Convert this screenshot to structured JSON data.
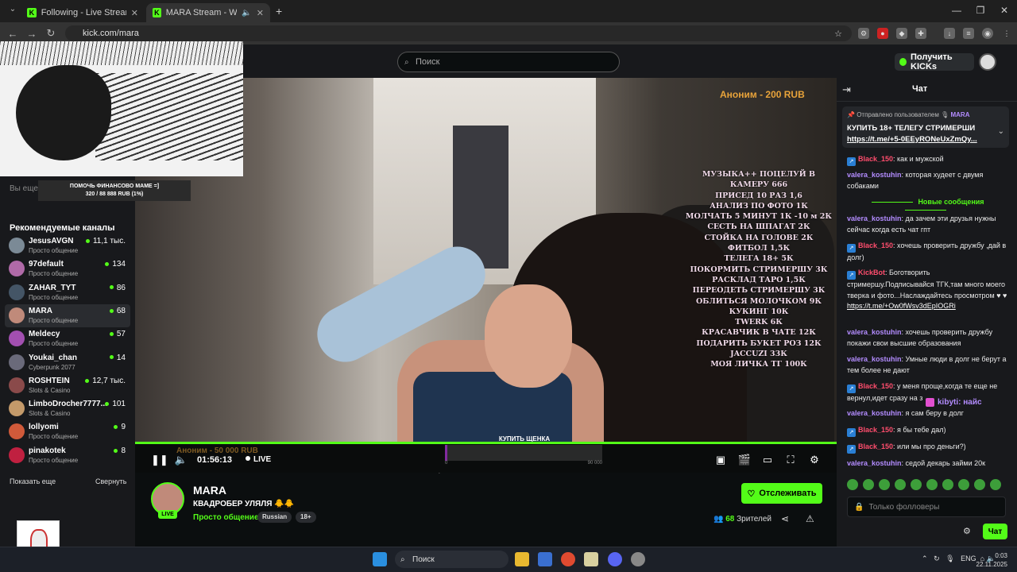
{
  "browser": {
    "tabs": [
      {
        "title": "Following - Live Streams on Kick",
        "active": false
      },
      {
        "title": "MARA Stream - Watch Live",
        "active": true
      }
    ],
    "url": "kick.com/mara",
    "add_tab_icon": "plus-icon"
  },
  "header": {
    "search_placeholder": "Поиск",
    "kicks_button": "Получить KICKs"
  },
  "overlay": {
    "donation_goal_title": "ПОМОЧЬ ФИНАНСОВО МАМЕ =]",
    "donation_goal_progress": "320 / 88 888 RUB (1%)",
    "donation_goal_fraction": 0.0036
  },
  "sidebar": {
    "following_text": "Вы еще ... один канал.",
    "recommended_title": "Рекомендуемые каналы",
    "channels": [
      {
        "name": "JesusAVGN",
        "category": "Просто общение",
        "viewers": "11,1 тыс.",
        "color": "#7b8a96"
      },
      {
        "name": "97default",
        "category": "Просто общение",
        "viewers": "134",
        "color": "#b06aa8"
      },
      {
        "name": "ZAHAR_TYT",
        "category": "Просто общение",
        "viewers": "86",
        "color": "#445566"
      },
      {
        "name": "MARA",
        "category": "Просто общение",
        "viewers": "68",
        "color": "#c08a7a"
      },
      {
        "name": "Meldecy",
        "category": "Просто общение",
        "viewers": "57",
        "color": "#a24fb0"
      },
      {
        "name": "Youkai_chan",
        "category": "Cyberpunk 2077",
        "viewers": "14",
        "color": "#6a6a7a"
      },
      {
        "name": "ROSHTEIN",
        "category": "Slots & Casino",
        "viewers": "12,7 тыс.",
        "color": "#8a4a4a"
      },
      {
        "name": "LimboDrocher7777...",
        "category": "Slots & Casino",
        "viewers": "101",
        "color": "#c49a6a"
      },
      {
        "name": "lollyomi",
        "category": "Просто общение",
        "viewers": "9",
        "color": "#d05a3a"
      },
      {
        "name": "pinakotek",
        "category": "Просто общение",
        "viewers": "8",
        "color": "#c02040"
      }
    ],
    "show_more": "Показать еще",
    "collapse": "Свернуть"
  },
  "video": {
    "donation_top": "Аноним - 200 RUB",
    "menu_lines": [
      "МУЗЫКА++ ПОЦЕЛУЙ В КАМЕРУ 666",
      "ПРИСЕД 10 РАЗ 1,6",
      "АНАЛИЗ ПО ФОТО 1К",
      "МОЛЧАТЬ 5 МИНУТ 1К -10 м 2К",
      "СЕСТЬ НА ШПАГАТ 2К",
      "СТОЙКА НА ГОЛОВЕ 2К",
      "ФИТБОЛ 1,5К",
      "ТЕЛЕГА 18+ 5К",
      "ПОКОРМИТЬ СТРИМЕРШУ 3К",
      "РАСКЛАД ТАРО 1,5К",
      "ПЕРЕОДЕТЬ СТРИМЕРШУ 3К",
      "ОБЛИТЬСЯ МОЛОЧКОМ 9К",
      "КУКИНГ 10К",
      "TWERK 6К",
      "КРАСАВЧИК В ЧАТЕ 12К",
      "ПОДАРИТЬ БУКЕТ РОЗ 12К",
      "JACCUZI 33К",
      "МОЯ ЛИЧКА ТГ 100К"
    ],
    "donation_bottom": "Аноним - 50 000 RUB",
    "buy_goal_label": "КУПИТЬ ЩЕНКА",
    "buy_goal_min": "0",
    "buy_goal_max": "90 000",
    "buy_goal_fraction": 0.01,
    "time": "01:56:13",
    "live_label": "LIVE"
  },
  "channel": {
    "name": "MARA",
    "live_badge": "LIVE",
    "title": "КВАДРОБЕР УЛЯЛЯ 🐥🐥",
    "category": "Просто общение",
    "tags": [
      "Russian",
      "18+"
    ],
    "follow_button": "Отслеживать",
    "viewers_count": "68",
    "viewers_label": "Зрителей"
  },
  "chat": {
    "title": "Чат",
    "pinned_header_prefix": "Отправлено пользователем",
    "pinned_by": "MARA",
    "pinned_text": "КУПИТЬ 18+ ТЕЛЕГУ СТРИМЕРШИ",
    "pinned_link": "https://t.me/+5-0EEyRONeUxZmQy...",
    "new_messages_label": "Новые сообщения",
    "gift_user": "kibyti: найс",
    "messages": [
      {
        "user": "Black_150",
        "cls": "black",
        "badge": true,
        "text": ": как и мужской"
      },
      {
        "user": "valera_kostuhin",
        "cls": "valera",
        "badge": false,
        "text": ": которая худеет с двумя собаками"
      },
      {
        "user": "valera_kostuhin",
        "cls": "valera",
        "badge": false,
        "text": ": да зачем эти друзья нужны сейчас когда есть чат гпт"
      },
      {
        "user": "Black_150",
        "cls": "black",
        "badge": true,
        "text": ": хочешь проверить дружбу ,дай в долг)"
      },
      {
        "user": "KickBot",
        "cls": "kickbot",
        "badge": true,
        "text": ": Боготворить стримершу.Подписывайся ТГК,там много моего тверка и фото...Наслаждайтесь просмотром ♥ ♥",
        "link": "https://t.me/+Ow0fWsv3dEpIOGRi"
      },
      {
        "user": "valera_kostuhin",
        "cls": "valera",
        "badge": false,
        "text": ": хочешь проверить дружбу покажи свои высшие образования"
      },
      {
        "user": "valera_kostuhin",
        "cls": "valera",
        "badge": false,
        "text": ": Умные люди в долг не берут а тем более не дают"
      },
      {
        "user": "Black_150",
        "cls": "black",
        "badge": true,
        "text": ": у меня проще,когда те еще не вернул,идет сразу на з"
      },
      {
        "user": "valera_kostuhin",
        "cls": "valera",
        "badge": false,
        "text": ": я сам беру в долг"
      },
      {
        "user": "Black_150",
        "cls": "black",
        "badge": true,
        "text": ": я бы тебе дал)"
      },
      {
        "user": "Black_150",
        "cls": "black",
        "badge": true,
        "text": ": или мы про деньги?)"
      },
      {
        "user": "valera_kostuhin",
        "cls": "valera",
        "badge": false,
        "text": ": седой декарь займи 20к"
      }
    ],
    "input_placeholder": "Только фолловеры",
    "send_button": "Чат"
  },
  "taskbar": {
    "search_placeholder": "Поиск",
    "language": "ENG",
    "time": "0:03",
    "date": "22.11.2025"
  },
  "colors": {
    "accent": "#53fc18",
    "chat_user_violet": "#b38cff",
    "chat_user_red": "#ff4d6d"
  }
}
